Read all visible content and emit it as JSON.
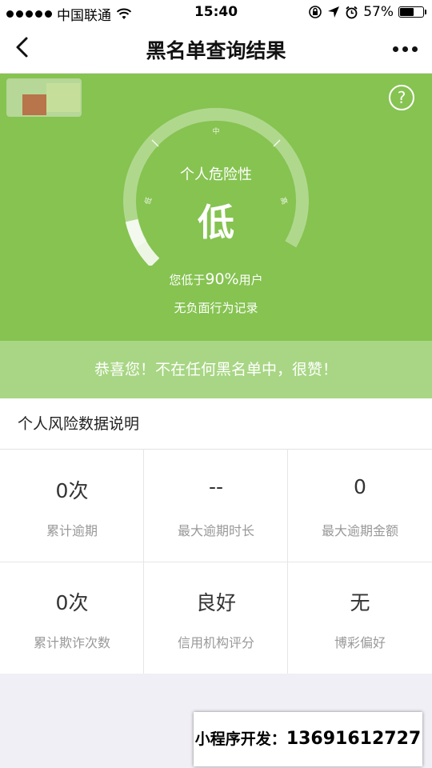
{
  "status_bar": {
    "carrier": "中国联通",
    "time": "15:40",
    "battery_percent": "57%",
    "battery_level": 0.57,
    "icons": [
      "signal-dots-icon",
      "wifi-icon",
      "rotation-lock-icon",
      "location-arrow-icon",
      "alarm-icon",
      "battery-icon"
    ]
  },
  "nav": {
    "title": "黑名单查询结果",
    "icons": [
      "back-arrow-icon",
      "more-dots-icon"
    ]
  },
  "risk": {
    "label": "个人危险性",
    "level": "低",
    "gauge_marks": {
      "low": "低",
      "mid": "中",
      "high": "高"
    },
    "percentile_prefix": "您低于",
    "percentile_value": "90%",
    "percentile_suffix": "用户",
    "record": "无负面行为记录",
    "gauge_fill_fraction": 0.12,
    "help_icon": "question-circle-icon",
    "help_text": "?"
  },
  "banner": {
    "text": "恭喜您！不在任何黑名单中，很赞！"
  },
  "details": {
    "title": "个人风险数据说明",
    "items": [
      {
        "value": "0次",
        "label": "累计逾期"
      },
      {
        "value": "--",
        "label": "最大逾期时长"
      },
      {
        "value": "0",
        "label": "最大逾期金额"
      },
      {
        "value": "0次",
        "label": "累计欺诈次数"
      },
      {
        "value": "良好",
        "label": "信用机构评分"
      },
      {
        "value": "无",
        "label": "博彩偏好"
      }
    ]
  },
  "promo": {
    "label": "小程序开发：",
    "phone": "13691612727"
  },
  "colors": {
    "hero_green": "#86c351",
    "banner_green": "#a8d684",
    "page_bg": "#f0eff5"
  }
}
